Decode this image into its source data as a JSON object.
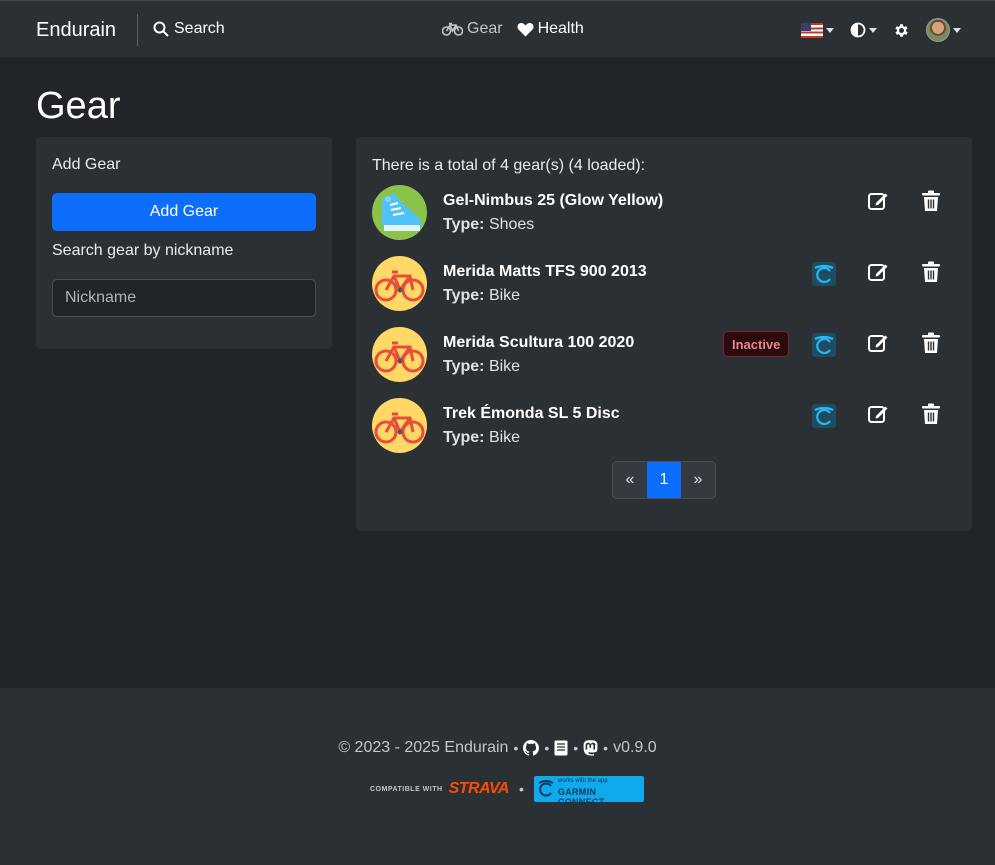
{
  "navbar": {
    "brand": "Endurain",
    "search_label": "Search",
    "gear_label": "Gear",
    "health_label": "Health"
  },
  "page": {
    "title": "Gear"
  },
  "sidebar": {
    "add_heading": "Add Gear",
    "add_button": "Add Gear",
    "search_heading": "Search gear by nickname",
    "search_placeholder": "Nickname"
  },
  "gear_list": {
    "total_text": "There is a total of 4 gear(s) (4 loaded):",
    "type_prefix": "Type:",
    "items": [
      {
        "name": "Gel-Nimbus 25 (Glow Yellow)",
        "type": "Shoes",
        "icon": "shoe-icon",
        "garmin": false,
        "status": ""
      },
      {
        "name": "Merida Matts TFS 900 2013",
        "type": "Bike",
        "icon": "bike-icon",
        "garmin": true,
        "status": ""
      },
      {
        "name": "Merida Scultura 100 2020",
        "type": "Bike",
        "icon": "bike-icon",
        "garmin": true,
        "status": "Inactive"
      },
      {
        "name": "Trek Émonda SL 5 Disc",
        "type": "Bike",
        "icon": "bike-icon",
        "garmin": true,
        "status": ""
      }
    ]
  },
  "pagination": {
    "prev": "«",
    "current": "1",
    "next": "»"
  },
  "footer": {
    "copyright": "© 2023 - 2025 Endurain",
    "version": "v0.9.0",
    "sep": "•",
    "strava_small": "COMPATIBLE WITH",
    "strava_word": "STRAVA",
    "garmin_top": "works with the app",
    "garmin_main": "GARMIN CONNECT"
  },
  "colors": {
    "accent": "#0d6efd",
    "background": "#212529",
    "panel": "#2b3035",
    "strava": "#fc4c02",
    "garmin": "#11a9ed"
  }
}
